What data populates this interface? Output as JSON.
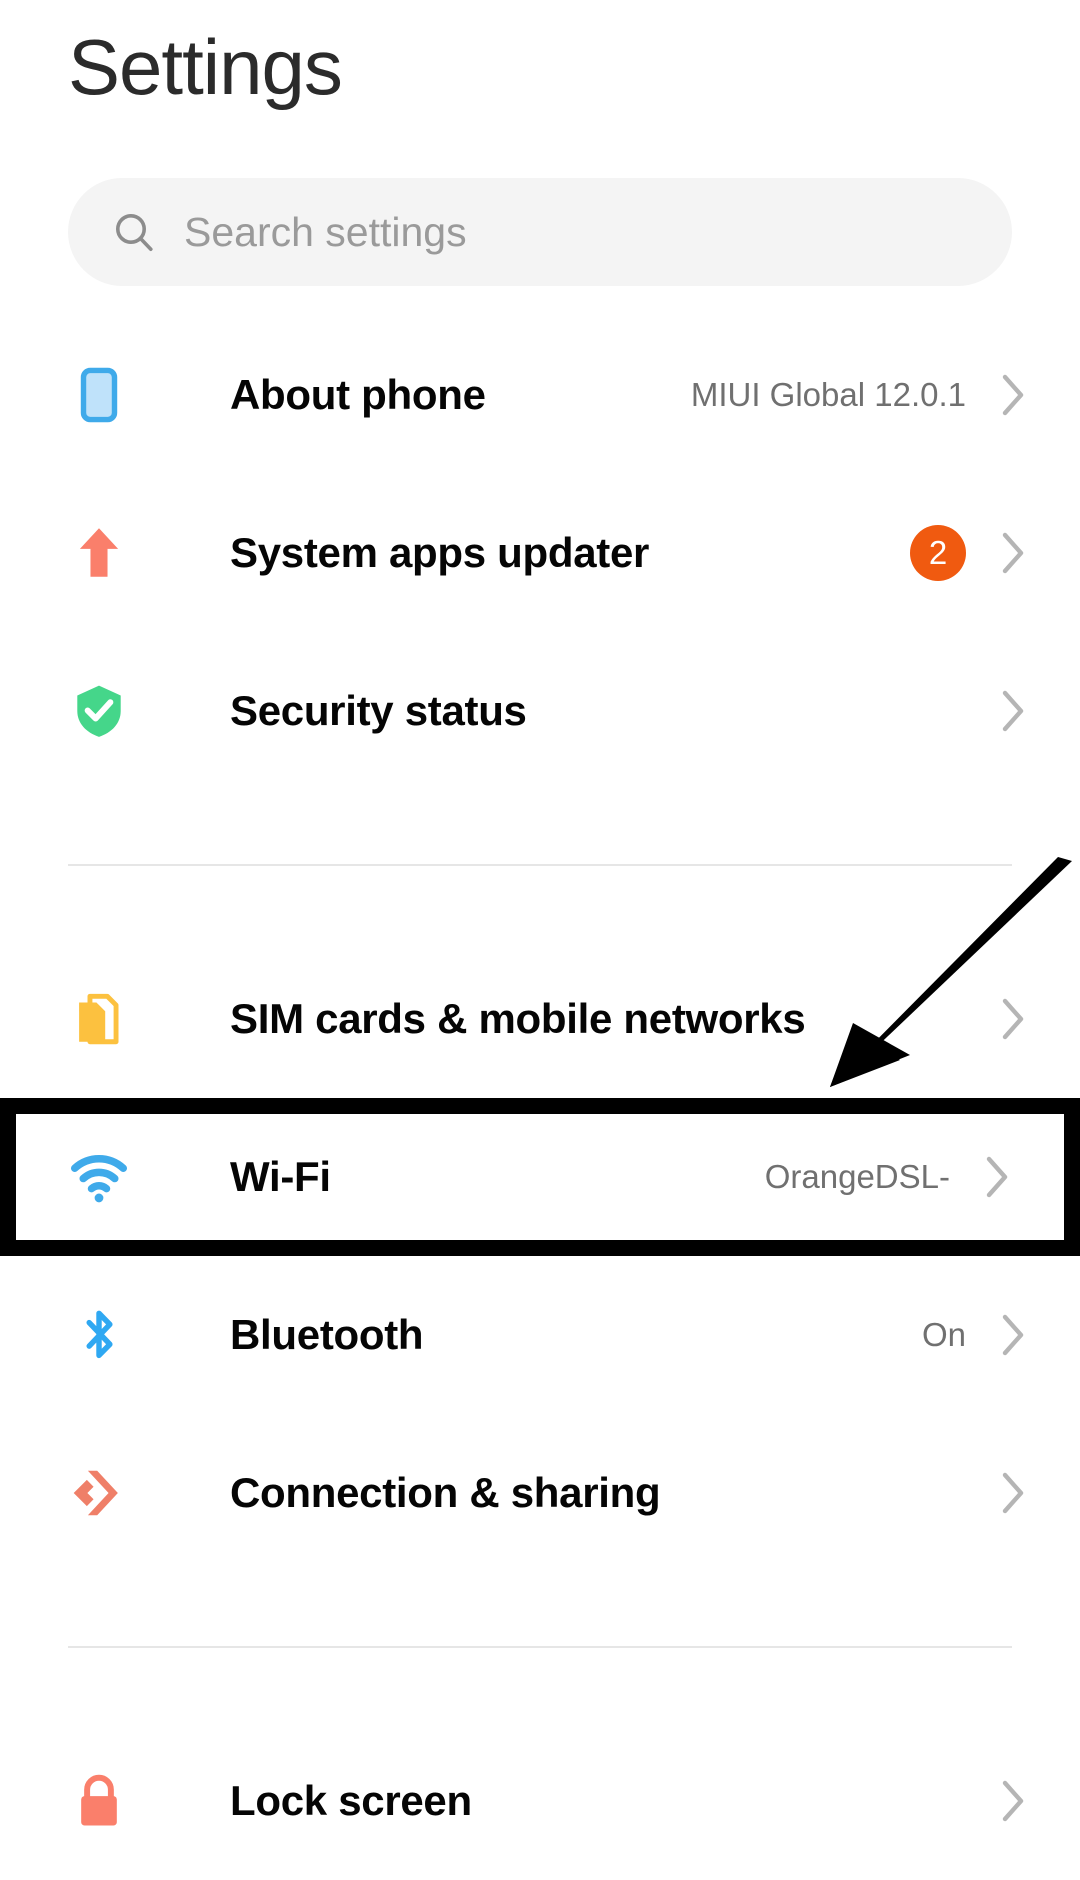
{
  "header": {
    "title": "Settings"
  },
  "search": {
    "placeholder": "Search settings",
    "icon": "search-icon"
  },
  "colors": {
    "badge_orange": "#f05a10",
    "phone_blue": "#3faaea",
    "phone_blue_fill": "#bfe2fa",
    "updater_coral": "#fa7f6b",
    "shield_green": "#45d68a",
    "sim_yellow": "#fcc13f",
    "wifi_blue": "#3faaea",
    "bluetooth_blue": "#2fa8f2",
    "sharing_coral": "#ef7f68",
    "lock_coral": "#fa7f6b",
    "highlight_black": "#000000",
    "divider_gray": "#e6e6e6",
    "chevron_gray": "#b5b5b5",
    "value_gray": "#707070"
  },
  "groups": [
    {
      "rows": [
        {
          "label": "About phone",
          "value": "MIUI Global 12.0.1",
          "icon": "phone-icon",
          "badge": null,
          "chevron": true,
          "highlighted": false
        },
        {
          "label": "System apps updater",
          "value": "",
          "icon": "up-arrow-icon",
          "badge": "2",
          "chevron": true,
          "highlighted": false
        },
        {
          "label": "Security status",
          "value": "",
          "icon": "shield-check-icon",
          "badge": null,
          "chevron": true,
          "highlighted": false
        }
      ]
    },
    {
      "rows": [
        {
          "label": "SIM cards & mobile networks",
          "value": "",
          "icon": "sim-card-icon",
          "badge": null,
          "chevron": true,
          "highlighted": false
        },
        {
          "label": "Wi-Fi",
          "value": "OrangeDSL-",
          "icon": "wifi-icon",
          "badge": null,
          "chevron": true,
          "highlighted": true
        },
        {
          "label": "Bluetooth",
          "value": "On",
          "icon": "bluetooth-icon",
          "badge": null,
          "chevron": true,
          "highlighted": false
        },
        {
          "label": "Connection & sharing",
          "value": "",
          "icon": "connection-sharing-icon",
          "badge": null,
          "chevron": true,
          "highlighted": false
        }
      ]
    },
    {
      "rows": [
        {
          "label": "Lock screen",
          "value": "",
          "icon": "lock-icon",
          "badge": null,
          "chevron": true,
          "highlighted": false
        }
      ]
    }
  ],
  "annotation": {
    "arrow": "pointer-arrow",
    "points_to": "Wi-Fi"
  }
}
